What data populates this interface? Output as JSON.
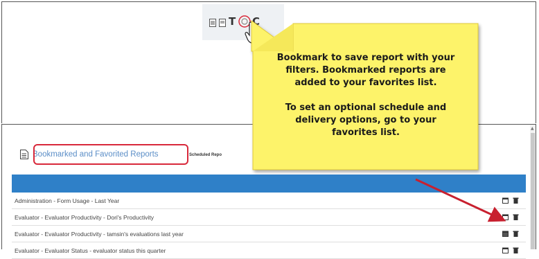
{
  "toolbar": {
    "letters": [
      "T",
      "C"
    ]
  },
  "callout": {
    "line1": "Bookmark to save report with your",
    "line2": "filters. Bookmarked reports are",
    "line3": "added to your favorites list.",
    "line4": "To set an optional schedule and",
    "line5": "delivery options, go to your",
    "line6": "favorites list.",
    "bg_color": "#fdf36b",
    "arrow_color": "#c8202f"
  },
  "panel": {
    "title": "Bookmarked and Favorited Reports",
    "subtitle": "Scheduled Repo",
    "band_color": "#2f80c8",
    "highlight_color": "#d8283a"
  },
  "reports": [
    {
      "label": "Administration - Form Usage - Last Year",
      "schedule_icon": "calendar-icon",
      "delete_icon": "trash-icon"
    },
    {
      "label": "Evaluator - Evaluator Productivity - Dori's Productivity",
      "schedule_icon": "calendar-icon",
      "delete_icon": "trash-icon"
    },
    {
      "label": "Evaluator - Evaluator Productivity - tamsin's evaluations last year",
      "schedule_icon": "calendar-filled-icon",
      "delete_icon": "trash-icon"
    },
    {
      "label": "Evaluator - Evaluator Status - evaluator status this quarter",
      "schedule_icon": "calendar-icon",
      "delete_icon": "trash-icon"
    }
  ]
}
